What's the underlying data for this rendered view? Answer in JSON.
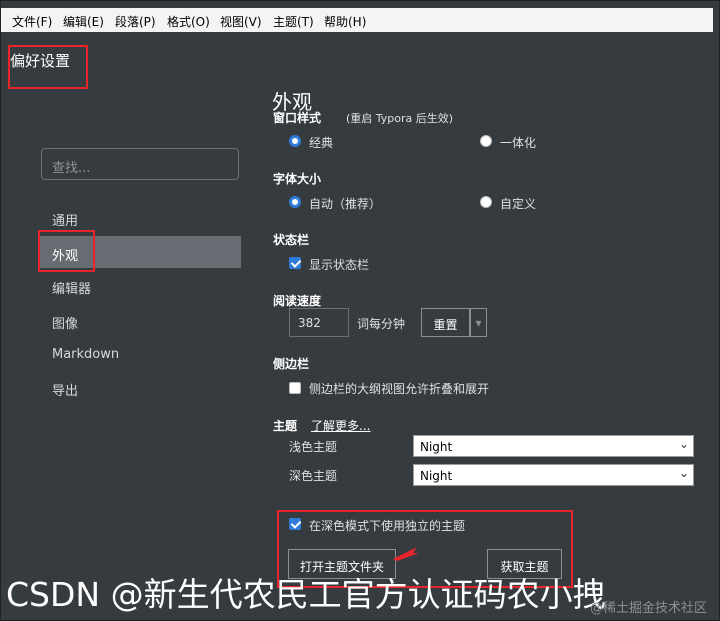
{
  "menu": [
    "文件(F)",
    "编辑(E)",
    "段落(P)",
    "格式(O)",
    "视图(V)",
    "主题(T)",
    "帮助(H)"
  ],
  "window_title": "偏好设置",
  "search": {
    "placeholder": "查找..."
  },
  "sidebar": {
    "items": [
      {
        "label": "通用"
      },
      {
        "label": "外观",
        "active": true
      },
      {
        "label": "编辑器"
      },
      {
        "label": "图像"
      },
      {
        "label": "Markdown"
      },
      {
        "label": "导出"
      }
    ]
  },
  "main": {
    "heading": "外观",
    "window_style": {
      "label": "窗口样式",
      "note": "(重启 Typora 后生效)",
      "options": [
        "经典",
        "一体化"
      ],
      "selected": "经典"
    },
    "font_size": {
      "label": "字体大小",
      "options": [
        "自动（推荐）",
        "自定义"
      ],
      "selected": "自动（推荐）"
    },
    "status_bar": {
      "label": "状态栏",
      "checkbox": "显示状态栏",
      "checked": true
    },
    "reading_speed": {
      "label": "阅读速度",
      "value": "382",
      "unit": "词每分钟",
      "reset": "重置",
      "dropdown": "▾"
    },
    "sidebar_section": {
      "label": "侧边栏",
      "checkbox": "侧边栏的大纲视图允许折叠和展开",
      "checked": false
    },
    "theme": {
      "label": "主题",
      "learn_more": "了解更多...",
      "light_label": "浅色主题",
      "light_value": "Night",
      "dark_label": "深色主题",
      "dark_value": "Night",
      "separate_checkbox": "在深色模式下使用独立的主题",
      "separate_checked": true,
      "open_folder": "打开主题文件夹",
      "get_themes": "获取主题"
    }
  },
  "watermark": {
    "main": "CSDN @新生代农民工官方认证码农小拽",
    "sub": "@稀土掘金技术社区"
  },
  "accent_color": "#2f7bd9",
  "highlight_color": "#e8252b"
}
